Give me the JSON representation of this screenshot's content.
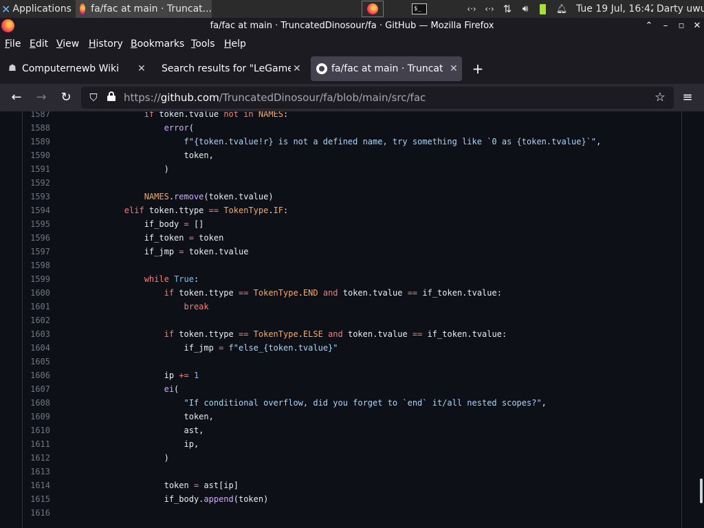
{
  "panel": {
    "applications_label": "Applications",
    "taskbar_window_title": "fa/fac at main · Truncat...",
    "clock": "Tue 19 Jul, 16:42",
    "user": "Darty uwu"
  },
  "window": {
    "title": "fa/fac at main · TruncatedDinosour/fa · GitHub — Mozilla Firefox"
  },
  "menu": [
    "File",
    "Edit",
    "View",
    "History",
    "Bookmarks",
    "Tools",
    "Help"
  ],
  "tabs": [
    {
      "label": "Computernewb Wiki",
      "icon": "wiki-icon",
      "active": false
    },
    {
      "label": "Search results for \"LeGamer",
      "icon": "none",
      "active": false
    },
    {
      "label": "fa/fac at main · Truncate",
      "icon": "github-icon",
      "active": true
    }
  ],
  "url": {
    "prefix": "https://",
    "host": "github.com",
    "path": "/TruncatedDinosour/fa/blob/main/src/fac"
  },
  "code": {
    "lines": [
      {
        "n": "1587",
        "t": [
          [
            "            ",
            ""
          ],
          [
            "if",
            "kw"
          ],
          [
            " token.tvalue ",
            ""
          ],
          [
            "not in",
            "kw"
          ],
          [
            " ",
            ""
          ],
          [
            "NAMES",
            "cls"
          ],
          [
            ":",
            ""
          ]
        ]
      },
      {
        "n": "1588",
        "t": [
          [
            "                ",
            ""
          ],
          [
            "error",
            "fn"
          ],
          [
            "(",
            ""
          ]
        ]
      },
      {
        "n": "1589",
        "t": [
          [
            "                    ",
            ""
          ],
          [
            "f\"{token.tvalue!r} is not a defined name, try something like `0 as {token.tvalue}`\"",
            "str"
          ],
          [
            ",",
            ""
          ]
        ]
      },
      {
        "n": "1590",
        "t": [
          [
            "                    token,",
            ""
          ]
        ]
      },
      {
        "n": "1591",
        "t": [
          [
            "                )",
            ""
          ]
        ]
      },
      {
        "n": "1592",
        "t": []
      },
      {
        "n": "1593",
        "t": [
          [
            "            ",
            ""
          ],
          [
            "NAMES",
            "cls"
          ],
          [
            ".",
            ""
          ],
          [
            "remove",
            "fn"
          ],
          [
            "(token.tvalue)",
            ""
          ]
        ]
      },
      {
        "n": "1594",
        "t": [
          [
            "        ",
            ""
          ],
          [
            "elif",
            "kw"
          ],
          [
            " token.ttype ",
            ""
          ],
          [
            "==",
            "kw"
          ],
          [
            " ",
            ""
          ],
          [
            "TokenType",
            "cls"
          ],
          [
            ".",
            ""
          ],
          [
            "IF",
            "cls"
          ],
          [
            ":",
            ""
          ]
        ]
      },
      {
        "n": "1595",
        "t": [
          [
            "            if_body ",
            ""
          ],
          [
            "=",
            "kw"
          ],
          [
            " []",
            ""
          ]
        ]
      },
      {
        "n": "1596",
        "t": [
          [
            "            if_token ",
            ""
          ],
          [
            "=",
            "kw"
          ],
          [
            " token",
            ""
          ]
        ]
      },
      {
        "n": "1597",
        "t": [
          [
            "            if_jmp ",
            ""
          ],
          [
            "=",
            "kw"
          ],
          [
            " token.tvalue",
            ""
          ]
        ]
      },
      {
        "n": "1598",
        "t": []
      },
      {
        "n": "1599",
        "t": [
          [
            "            ",
            ""
          ],
          [
            "while",
            "kw"
          ],
          [
            " ",
            ""
          ],
          [
            "True",
            "bi"
          ],
          [
            ":",
            ""
          ]
        ]
      },
      {
        "n": "1600",
        "t": [
          [
            "                ",
            ""
          ],
          [
            "if",
            "kw"
          ],
          [
            " token.ttype ",
            ""
          ],
          [
            "==",
            "kw"
          ],
          [
            " ",
            ""
          ],
          [
            "TokenType",
            "cls"
          ],
          [
            ".",
            ""
          ],
          [
            "END",
            "cls"
          ],
          [
            " ",
            ""
          ],
          [
            "and",
            "kw"
          ],
          [
            " token.tvalue ",
            ""
          ],
          [
            "==",
            "kw"
          ],
          [
            " if_token.tvalue:",
            ""
          ]
        ]
      },
      {
        "n": "1601",
        "t": [
          [
            "                    ",
            ""
          ],
          [
            "break",
            "kw"
          ]
        ]
      },
      {
        "n": "1602",
        "t": []
      },
      {
        "n": "1603",
        "t": [
          [
            "                ",
            ""
          ],
          [
            "if",
            "kw"
          ],
          [
            " token.ttype ",
            ""
          ],
          [
            "==",
            "kw"
          ],
          [
            " ",
            ""
          ],
          [
            "TokenType",
            "cls"
          ],
          [
            ".",
            ""
          ],
          [
            "ELSE",
            "cls"
          ],
          [
            " ",
            ""
          ],
          [
            "and",
            "kw"
          ],
          [
            " token.tvalue ",
            ""
          ],
          [
            "==",
            "kw"
          ],
          [
            " if_token.tvalue:",
            ""
          ]
        ]
      },
      {
        "n": "1604",
        "t": [
          [
            "                    if_jmp ",
            ""
          ],
          [
            "=",
            "kw"
          ],
          [
            " ",
            ""
          ],
          [
            "f\"else_{token.tvalue}\"",
            "str"
          ]
        ]
      },
      {
        "n": "1605",
        "t": []
      },
      {
        "n": "1606",
        "t": [
          [
            "                ip ",
            ""
          ],
          [
            "+=",
            "kw"
          ],
          [
            " ",
            ""
          ],
          [
            "1",
            "bi"
          ]
        ]
      },
      {
        "n": "1607",
        "t": [
          [
            "                ",
            ""
          ],
          [
            "ei",
            "fn"
          ],
          [
            "(",
            ""
          ]
        ]
      },
      {
        "n": "1608",
        "t": [
          [
            "                    ",
            ""
          ],
          [
            "\"If conditional overflow, did you forget to `end` it/all nested scopes?\"",
            "str"
          ],
          [
            ",",
            ""
          ]
        ]
      },
      {
        "n": "1609",
        "t": [
          [
            "                    token,",
            ""
          ]
        ]
      },
      {
        "n": "1610",
        "t": [
          [
            "                    ast,",
            ""
          ]
        ]
      },
      {
        "n": "1611",
        "t": [
          [
            "                    ip,",
            ""
          ]
        ]
      },
      {
        "n": "1612",
        "t": [
          [
            "                )",
            ""
          ]
        ]
      },
      {
        "n": "1613",
        "t": []
      },
      {
        "n": "1614",
        "t": [
          [
            "                token ",
            ""
          ],
          [
            "=",
            "kw"
          ],
          [
            " ast[ip]",
            ""
          ]
        ]
      },
      {
        "n": "1615",
        "t": [
          [
            "                if_body.",
            ""
          ],
          [
            "append",
            "fn"
          ],
          [
            "(token)",
            ""
          ]
        ]
      },
      {
        "n": "1616",
        "t": []
      }
    ]
  },
  "colors": {
    "code_bg": "#0d1117",
    "keyword": "#ff7b72",
    "string": "#a5d6ff",
    "function": "#d2a8ff",
    "class": "#ffa657",
    "constant": "#79c0ff"
  }
}
